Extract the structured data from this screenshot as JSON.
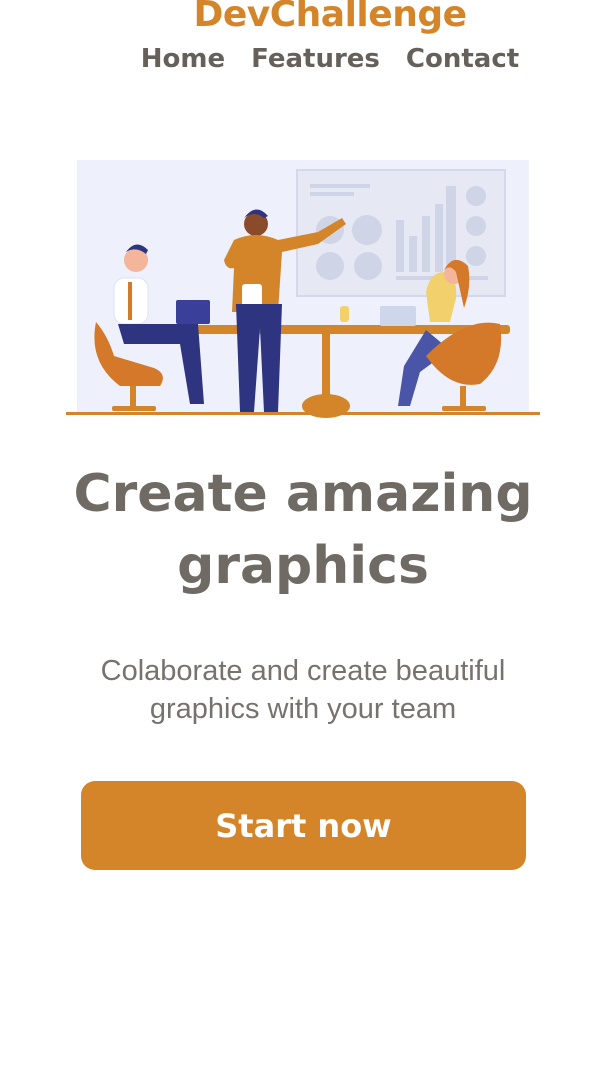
{
  "header": {
    "brand": "DevChallenge",
    "nav": [
      "Home",
      "Features",
      "Contact"
    ]
  },
  "hero": {
    "headline_line1": "Create amazing",
    "headline_line2": "graphics",
    "subtitle_line1": "Colaborate and create beautiful",
    "subtitle_line2": "graphics with your team",
    "cta_label": "Start now"
  },
  "colors": {
    "accent": "#d4852a",
    "heading": "#6f6a64",
    "text": "#77726d",
    "illustration_bg": "#eef1fb",
    "navy": "#2e3480"
  }
}
